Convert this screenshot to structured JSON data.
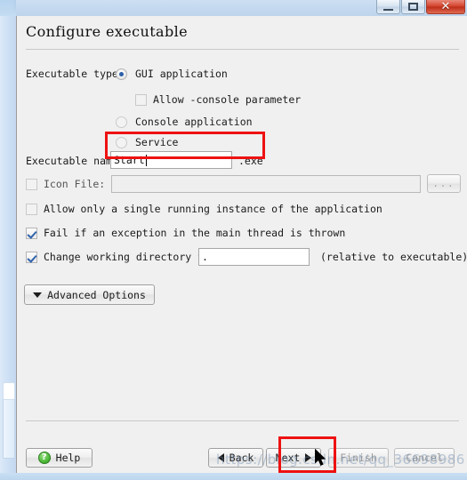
{
  "window": {
    "controls": {
      "minimize_label": "minimize",
      "maximize_label": "maximize",
      "close_label": "✕"
    }
  },
  "dialog": {
    "title": "Configure executable"
  },
  "form": {
    "executable_type_label": "Executable type:",
    "radios": [
      {
        "label": "GUI application",
        "checked": true,
        "enabled": true
      },
      {
        "label": "Console application",
        "checked": false,
        "enabled": false
      },
      {
        "label": "Service",
        "checked": false,
        "enabled": false
      }
    ],
    "allow_console_param": {
      "label": "Allow -console parameter",
      "checked": false,
      "enabled": false
    },
    "executable_name": {
      "label": "Executable name",
      "value": "Start",
      "suffix": ".exe"
    },
    "icon_file": {
      "label": "Icon File:",
      "checked": false,
      "value": "",
      "browse_label": "..."
    },
    "single_instance": {
      "label": "Allow only a single running instance of the application",
      "checked": false
    },
    "fail_on_exception": {
      "label": "Fail if an exception in the main thread is thrown",
      "checked": true
    },
    "change_working_dir": {
      "label": "Change working directory to:",
      "checked": true,
      "value": ".",
      "note": "(relative to executable)"
    },
    "advanced_options_label": "Advanced Options"
  },
  "footer": {
    "help_label": "Help",
    "help_icon_glyph": "?",
    "back_label": "Back",
    "next_label": "Next",
    "finish_label": "Finish",
    "cancel_label": "Cancel"
  },
  "watermark": {
    "text": "https://blog.csdn.net/qq_36698986"
  },
  "annotations": {
    "highlight_color": "#ee1111",
    "boxes": [
      {
        "name": "executable-name-highlight"
      },
      {
        "name": "next-button-highlight"
      }
    ]
  }
}
